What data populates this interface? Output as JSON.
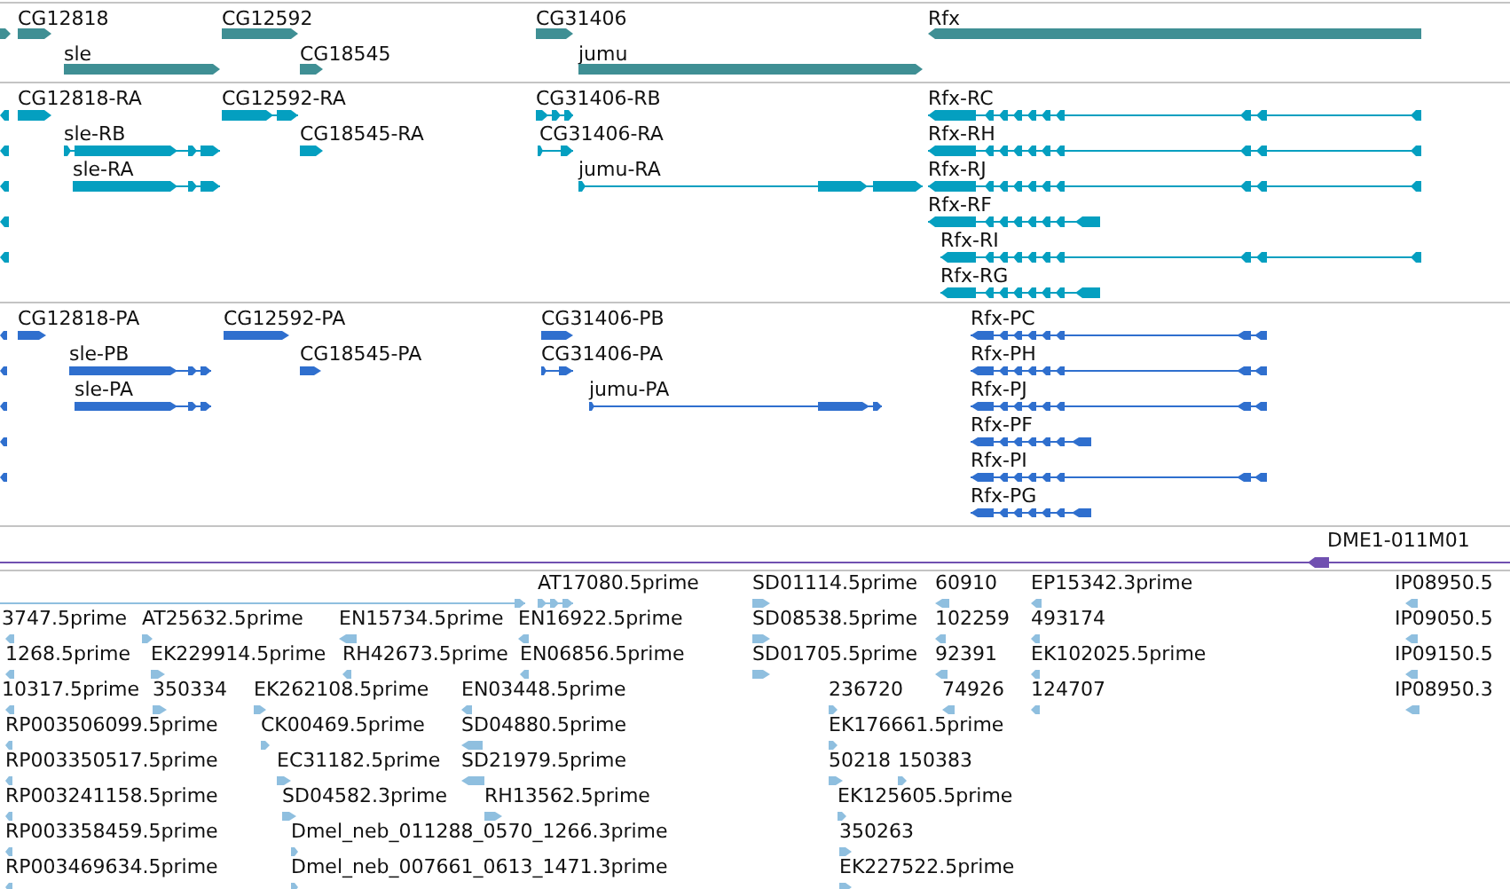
{
  "tracks": [
    {
      "color": "#3f8f94",
      "features": [
        {
          "reverse": false
        },
        {
          "label": "CG12818",
          "reverse": false
        },
        {
          "label": "CG12592",
          "reverse": false
        },
        {
          "label": "CG31406",
          "reverse": false
        },
        {
          "label": "Rfx",
          "reverse": true
        },
        {
          "label": "sle",
          "reverse": false
        },
        {
          "label": "CG18545",
          "reverse": false
        },
        {
          "label": "jumu",
          "reverse": false
        }
      ]
    },
    {
      "color": "#049fc0",
      "features": [
        {
          "reverse": true
        },
        {
          "label": "CG12818-RA",
          "reverse": false
        },
        {
          "label": "CG12592-RA",
          "reverse": false
        },
        {
          "label": "CG31406-RB",
          "reverse": false
        },
        {
          "label": "Rfx-RC",
          "reverse": true
        },
        {
          "reverse": true
        },
        {
          "label": "sle-RB",
          "reverse": false
        },
        {
          "label": "CG18545-RA",
          "reverse": false
        },
        {
          "label": "CG31406-RA",
          "reverse": false
        },
        {
          "label": "Rfx-RH",
          "reverse": true
        },
        {
          "reverse": true
        },
        {
          "label": "sle-RA",
          "reverse": false
        },
        {
          "label": "jumu-RA",
          "reverse": false
        },
        {
          "label": "Rfx-RJ",
          "reverse": true
        },
        {
          "reverse": true
        },
        {
          "label": "Rfx-RF",
          "reverse": true
        },
        {
          "reverse": true
        },
        {
          "label": "Rfx-RI",
          "reverse": true
        },
        {
          "label": "Rfx-RG",
          "reverse": true
        }
      ]
    },
    {
      "color": "#2f6fce",
      "features": [
        {
          "reverse": true
        },
        {
          "label": "CG12818-PA",
          "reverse": false
        },
        {
          "label": "CG12592-PA",
          "reverse": false
        },
        {
          "label": "CG31406-PB",
          "reverse": false
        },
        {
          "label": "Rfx-PC",
          "reverse": true
        },
        {
          "reverse": true
        },
        {
          "label": "sle-PB",
          "reverse": false
        },
        {
          "label": "CG18545-PA",
          "reverse": false
        },
        {
          "label": "CG31406-PA",
          "reverse": false
        },
        {
          "label": "Rfx-PH",
          "reverse": true
        },
        {
          "reverse": true
        },
        {
          "label": "sle-PA",
          "reverse": false
        },
        {
          "label": "jumu-PA",
          "reverse": false
        },
        {
          "label": "Rfx-PJ",
          "reverse": true
        },
        {
          "reverse": true
        },
        {
          "label": "Rfx-PF",
          "reverse": true
        },
        {
          "reverse": true
        },
        {
          "label": "Rfx-PI",
          "reverse": true
        },
        {
          "label": "Rfx-PG",
          "reverse": true
        }
      ]
    },
    {
      "color": "#7050b0",
      "features": [
        {
          "label": "DME1-011M01",
          "reverse": true
        }
      ]
    },
    {
      "color": "#8fbfdf",
      "features": [
        {
          "reverse": false
        },
        {
          "label": "AT17080.5prime",
          "reverse": false
        },
        {
          "label": "SD01114.5prime",
          "reverse": false
        },
        {
          "label": "60910",
          "reverse": true
        },
        {
          "label": "EP15342.3prime",
          "reverse": true
        },
        {
          "label": "IP08950.5",
          "reverse": true
        },
        {
          "label": "3747.5prime",
          "reverse": true
        },
        {
          "label": "AT25632.5prime",
          "reverse": false
        },
        {
          "label": "EN15734.5prime",
          "reverse": true
        },
        {
          "label": "EN16922.5prime",
          "reverse": true
        },
        {
          "label": "SD08538.5prime",
          "reverse": false
        },
        {
          "label": "102259",
          "reverse": true
        },
        {
          "label": "493174",
          "reverse": true
        },
        {
          "label": "IP09050.5",
          "reverse": true
        },
        {
          "label": "1268.5prime",
          "reverse": true
        },
        {
          "label": "EK229914.5prime",
          "reverse": false
        },
        {
          "label": "RH42673.5prime",
          "reverse": true
        },
        {
          "label": "EN06856.5prime",
          "reverse": true
        },
        {
          "label": "SD01705.5prime",
          "reverse": false
        },
        {
          "label": "92391",
          "reverse": true
        },
        {
          "label": "EK102025.5prime",
          "reverse": true
        },
        {
          "label": "IP09150.5",
          "reverse": true
        },
        {
          "label": "10317.5prime",
          "reverse": true
        },
        {
          "label": "350334",
          "reverse": false
        },
        {
          "label": "EK262108.5prime",
          "reverse": false
        },
        {
          "label": "EN03448.5prime",
          "reverse": true
        },
        {
          "label": "236720",
          "reverse": false
        },
        {
          "label": "74926",
          "reverse": true
        },
        {
          "label": "124707",
          "reverse": true
        },
        {
          "label": "IP08950.3",
          "reverse": true
        },
        {
          "label": "RP003506099.5prime",
          "reverse": true
        },
        {
          "label": "CK00469.5prime",
          "reverse": false
        },
        {
          "label": "SD04880.5prime",
          "reverse": true
        },
        {
          "label": "EK176661.5prime",
          "reverse": false
        },
        {
          "label": "RP003350517.5prime",
          "reverse": true
        },
        {
          "label": "EC31182.5prime",
          "reverse": false
        },
        {
          "label": "SD21979.5prime",
          "reverse": true
        },
        {
          "label": "50218",
          "reverse": false
        },
        {
          "label": "150383",
          "reverse": false
        },
        {
          "label": "RP003241158.5prime",
          "reverse": true
        },
        {
          "label": "SD04582.3prime",
          "reverse": false
        },
        {
          "label": "RH13562.5prime",
          "reverse": false
        },
        {
          "label": "EK125605.5prime",
          "reverse": false
        },
        {
          "label": "RP003358459.5prime",
          "reverse": true
        },
        {
          "label": "Dmel_neb_011288_0570_1266.3prime",
          "reverse": false
        },
        {
          "label": "350263",
          "reverse": false
        },
        {
          "label": "RP003469634.5prime",
          "reverse": true
        },
        {
          "label": "Dmel_neb_007661_0613_1471.3prime",
          "reverse": false
        },
        {
          "label": "EK227522.5prime",
          "reverse": false
        }
      ]
    }
  ]
}
